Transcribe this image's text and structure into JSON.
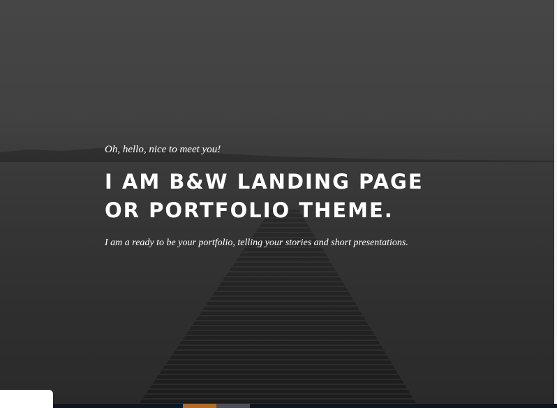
{
  "hero": {
    "tagline": "Oh, hello, nice to meet you!",
    "headline_line1": "I AM B&W LANDING PAGE",
    "headline_line2": "OR PORTFOLIO THEME.",
    "subtitle": "I am a ready to be your portfolio, telling your stories and short presentations."
  },
  "colors": {
    "text": "#ffffff",
    "sky": "#464646",
    "water": "#2a2a2a",
    "dock": "#202020"
  },
  "icons": {
    "background": "pier-photo"
  }
}
